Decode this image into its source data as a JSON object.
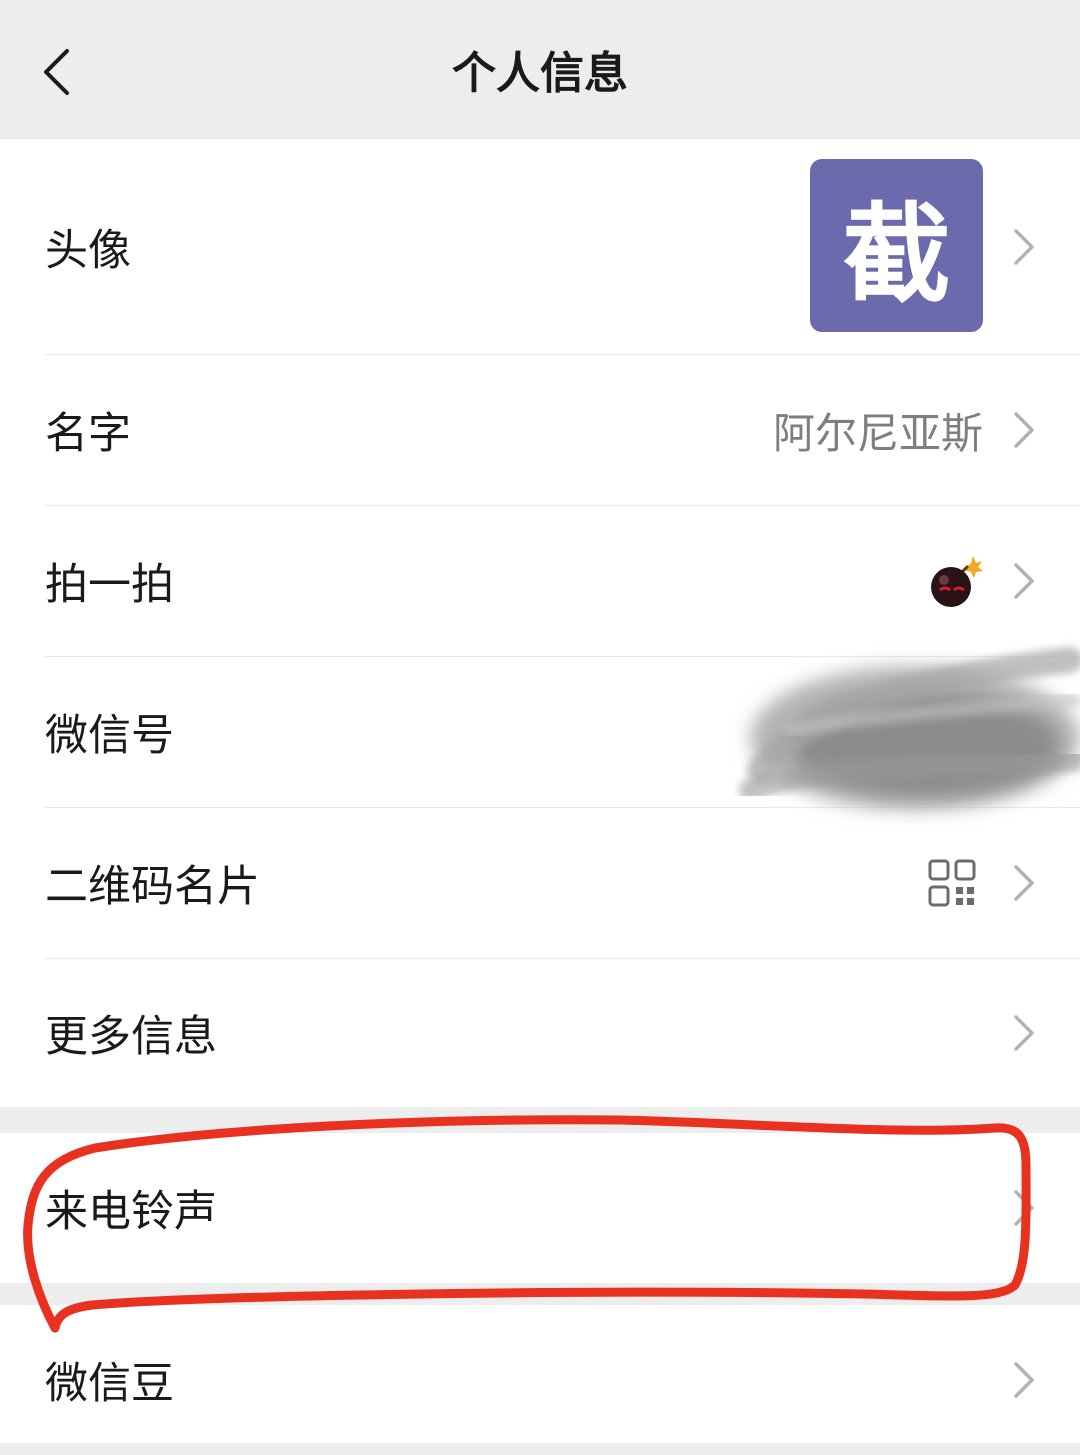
{
  "navbar": {
    "title": "个人信息",
    "back_icon": "chevron-left-icon"
  },
  "rows": {
    "avatar": {
      "label": "头像",
      "avatar_text": "截",
      "avatar_color": "#6a6aad"
    },
    "name": {
      "label": "名字",
      "value": "阿尔尼亚斯"
    },
    "pat": {
      "label": "拍一拍",
      "icon": "bomb-icon"
    },
    "wechat_id": {
      "label": "微信号",
      "note": "value obscured by scribble"
    },
    "qr_card": {
      "label": "二维码名片",
      "icon": "qr-code-icon"
    },
    "more_info": {
      "label": "更多信息"
    },
    "ringtone": {
      "label": "来电铃声"
    },
    "wechat_beans": {
      "label": "微信豆"
    }
  },
  "colors": {
    "background": "#ededed",
    "row_background": "#ffffff",
    "annotation": "#e8321f",
    "secondary_text": "#7f7f7f"
  }
}
